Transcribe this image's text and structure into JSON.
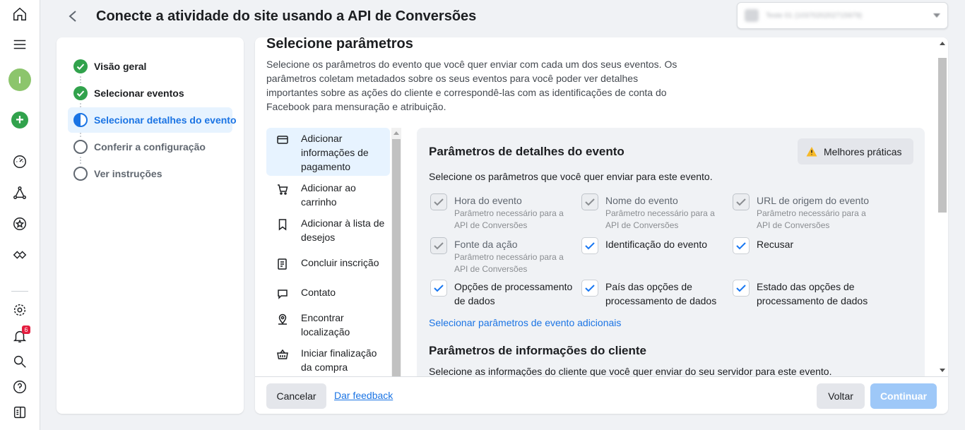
{
  "header": {
    "title": "Conecte a atividade do site usando a API de Conversões",
    "account_selector": "Teste 01 (1037020202715979)"
  },
  "rail": {
    "notification_count": "6",
    "avatar_initial": "I"
  },
  "steps": [
    {
      "label": "Visão geral",
      "state": "done"
    },
    {
      "label": "Selecionar eventos",
      "state": "done"
    },
    {
      "label": "Selecionar detalhes do evento",
      "state": "current"
    },
    {
      "label": "Conferir a configuração",
      "state": "todo"
    },
    {
      "label": "Ver instruções",
      "state": "todo"
    }
  ],
  "main": {
    "heading": "Selecione parâmetros",
    "description": "Selecione os parâmetros do evento que você quer enviar com cada um dos seus eventos. Os parâmetros coletam metadados sobre os seus eventos para você poder ver detalhes importantes sobre as ações do cliente e correspondê-las com as identificações de conta do Facebook para mensuração e atribuição."
  },
  "events": [
    {
      "label": "Adicionar informações de pagamento",
      "icon": "credit-card-icon"
    },
    {
      "label": "Adicionar ao carrinho",
      "icon": "cart-icon"
    },
    {
      "label": "Adicionar à lista de desejos",
      "icon": "bookmark-icon"
    },
    {
      "label": "Concluir inscrição",
      "icon": "form-icon"
    },
    {
      "label": "Contato",
      "icon": "chat-icon"
    },
    {
      "label": "Encontrar localização",
      "icon": "location-icon"
    },
    {
      "label": "Iniciar finalização da compra",
      "icon": "basket-icon"
    }
  ],
  "params_panel": {
    "title": "Parâmetros de detalhes do evento",
    "best_practices": "Melhores práticas",
    "description": "Selecione os parâmetros que você quer enviar para este evento.",
    "required_note": "Parâmetro necessário para a API de Conversões",
    "params": [
      {
        "label": "Hora do evento",
        "checked": true,
        "disabled": true
      },
      {
        "label": "Nome do evento",
        "checked": true,
        "disabled": true
      },
      {
        "label": "URL de origem do evento",
        "checked": true,
        "disabled": true
      },
      {
        "label": "Fonte da ação",
        "checked": true,
        "disabled": true
      },
      {
        "label": "Identificação do evento",
        "checked": true,
        "disabled": false
      },
      {
        "label": "Recusar",
        "checked": true,
        "disabled": false
      },
      {
        "label": "Opções de processamento de dados",
        "checked": true,
        "disabled": false
      },
      {
        "label": "País das opções de processamento de dados",
        "checked": true,
        "disabled": false
      },
      {
        "label": "Estado das opções de processamento de dados",
        "checked": true,
        "disabled": false
      }
    ],
    "more_link": "Selecionar parâmetros de evento adicionais",
    "customer_title": "Parâmetros de informações do cliente",
    "customer_desc": "Selecione as informações do cliente que você quer enviar do seu servidor para este evento."
  },
  "footer": {
    "cancel": "Cancelar",
    "feedback": "Dar feedback",
    "back": "Voltar",
    "continue": "Continuar"
  },
  "colors": {
    "accent": "#1b74e4",
    "success": "#31a24c",
    "continue_disabled": "#9ec8f8"
  }
}
